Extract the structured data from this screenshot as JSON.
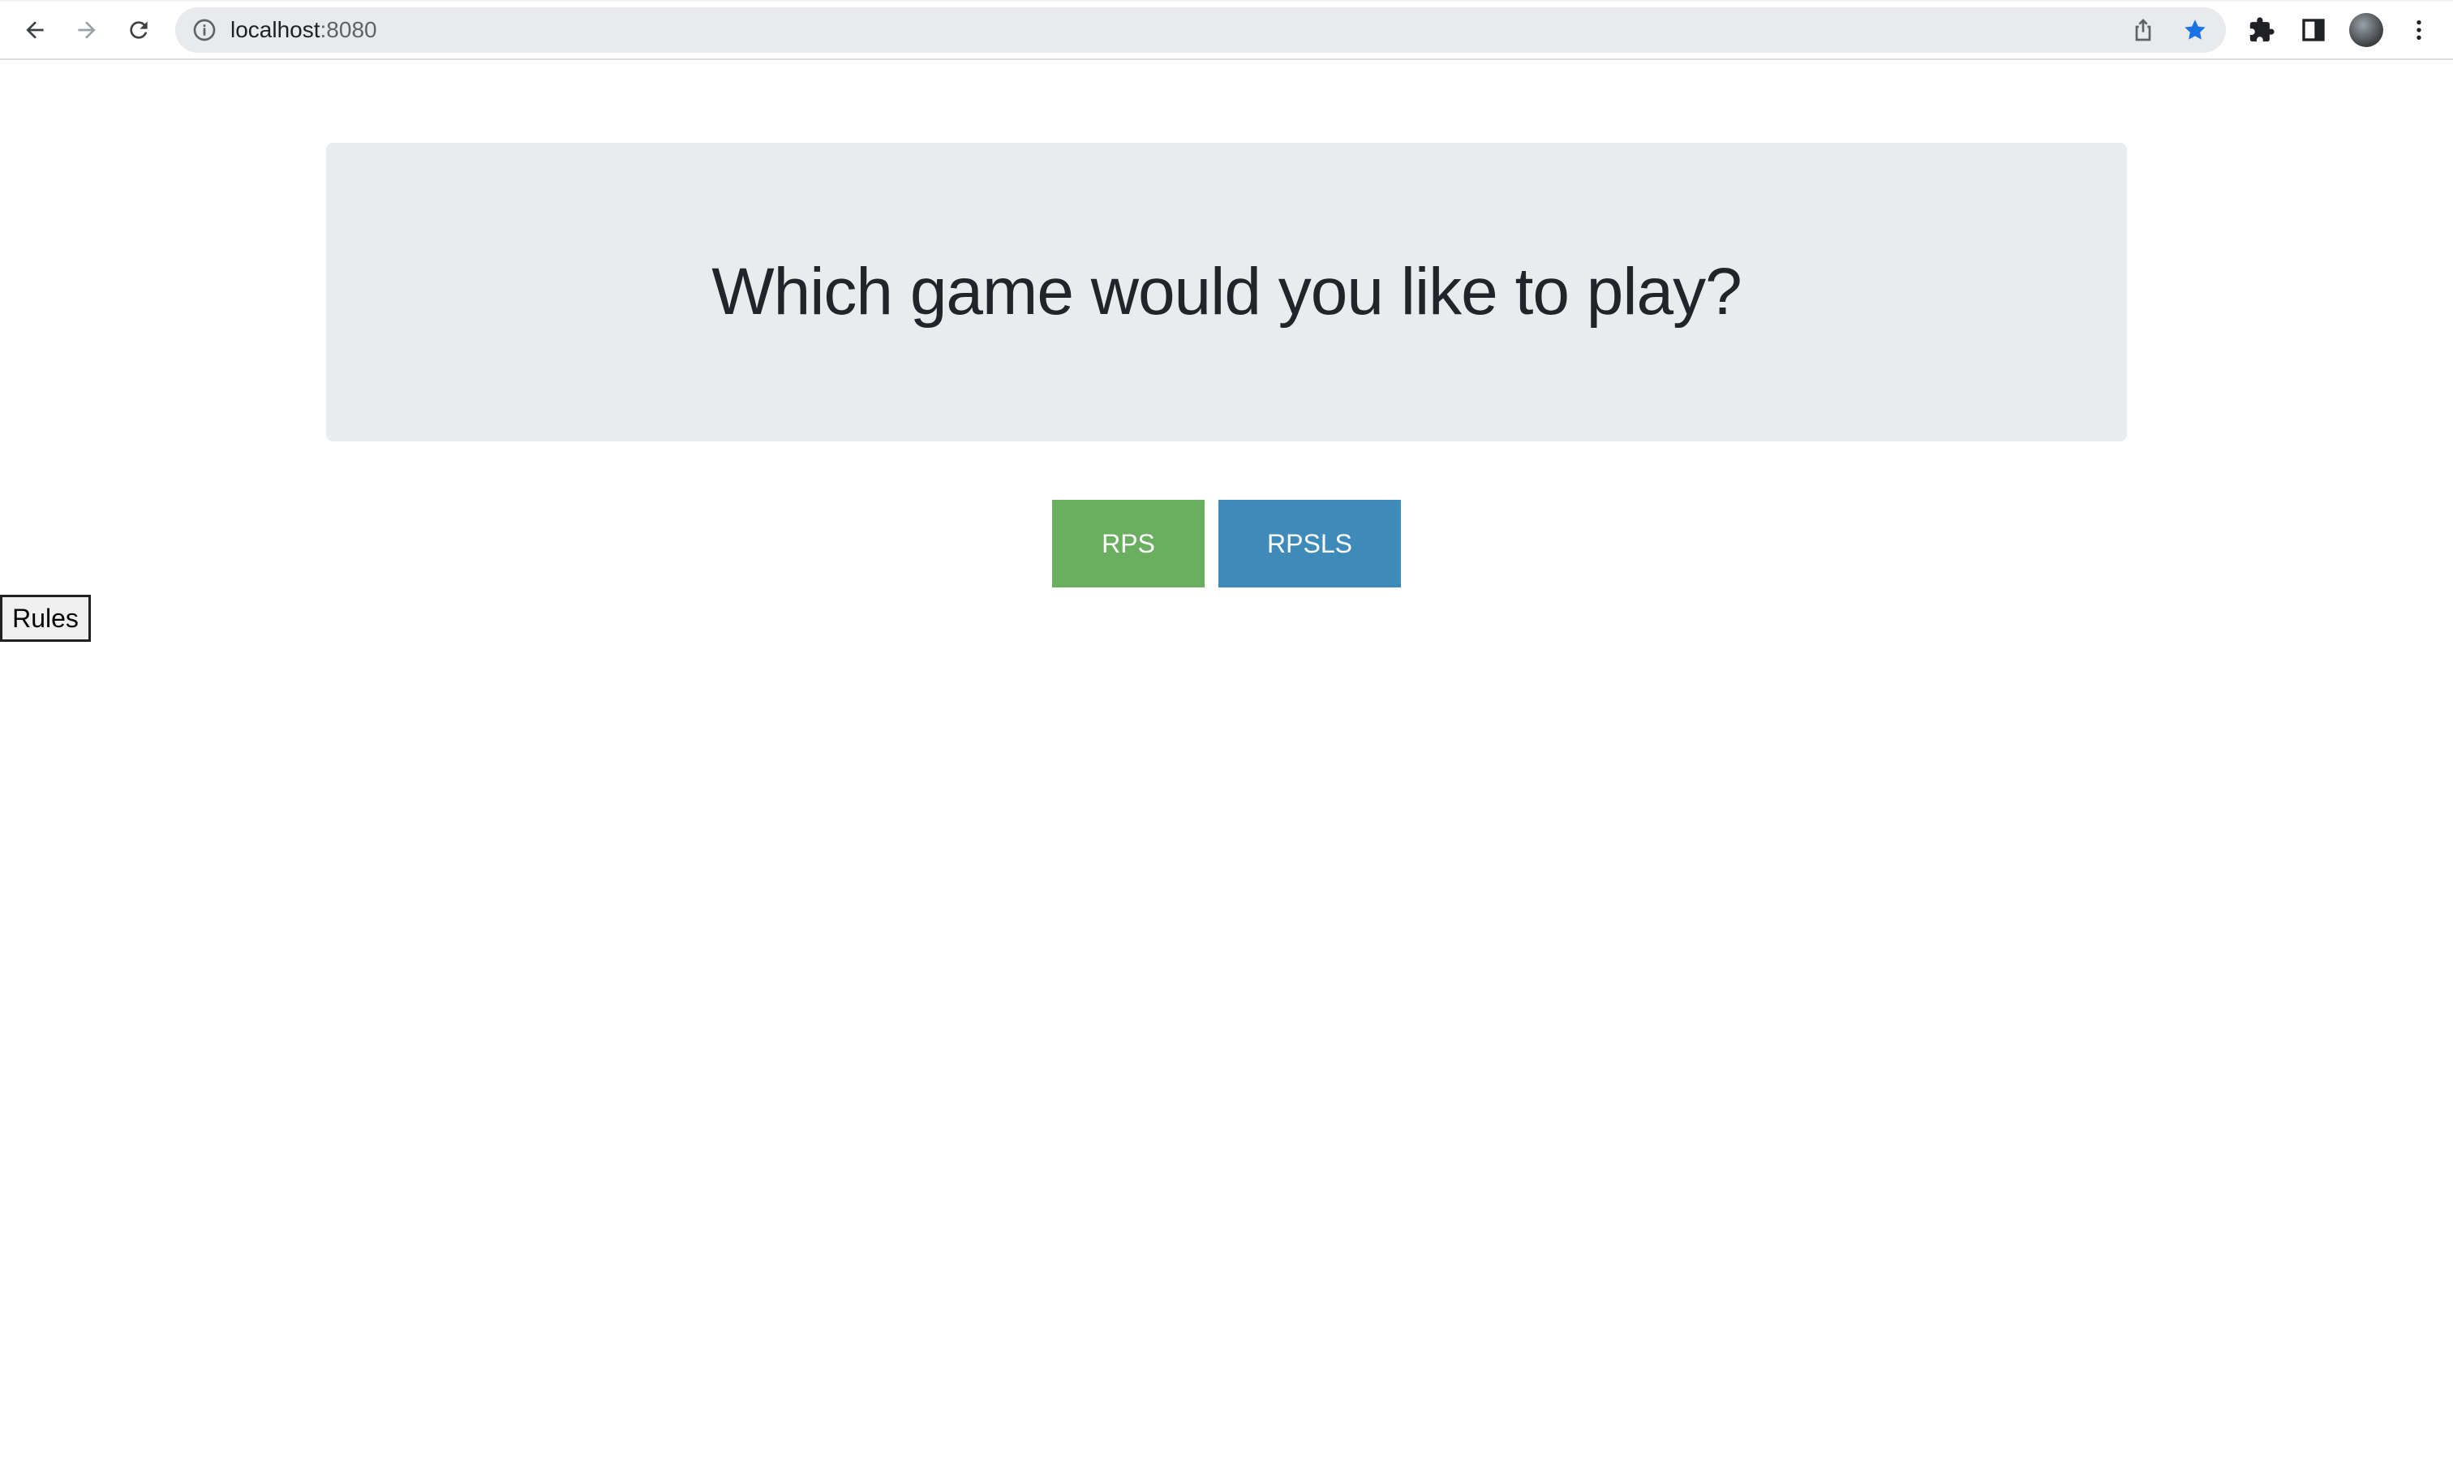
{
  "browser": {
    "url_host": "localhost",
    "url_port": ":8080",
    "icons": {
      "back": "back-arrow-icon",
      "forward": "forward-arrow-icon",
      "reload": "reload-icon",
      "site_info": "info-icon",
      "share": "share-icon",
      "bookmark": "star-icon",
      "extensions": "puzzle-icon",
      "side_panel": "side-panel-icon",
      "menu": "kebab-menu-icon"
    },
    "bookmark_color": "#1a73e8"
  },
  "page": {
    "heading": "Which game would you like to play?",
    "buttons": {
      "rps_label": "RPS",
      "rpsls_label": "RPSLS",
      "rules_label": "Rules"
    },
    "colors": {
      "rps": "#6aaf5f",
      "rpsls": "#3e8ab8",
      "jumbotron": "#e9ecef"
    }
  }
}
